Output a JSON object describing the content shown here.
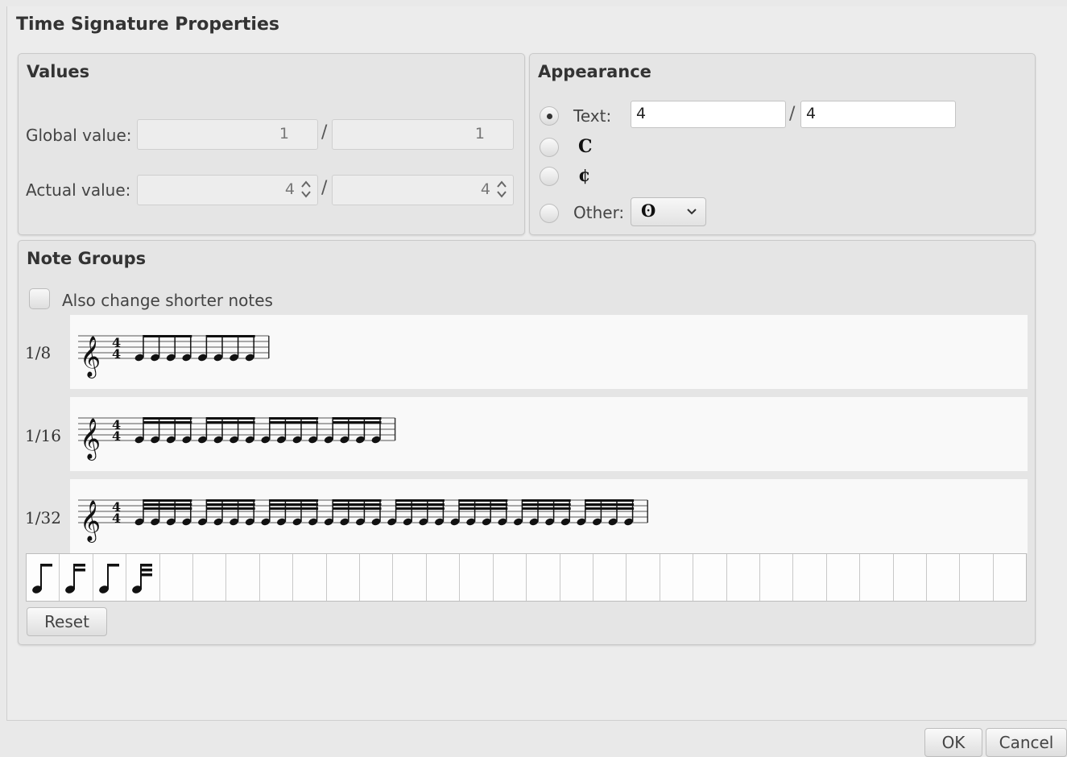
{
  "dialog": {
    "title": "Time Signature Properties",
    "ok_label": "OK",
    "cancel_label": "Cancel"
  },
  "values": {
    "title": "Values",
    "global_label": "Global value:",
    "global_numerator": "1",
    "global_denominator": "1",
    "actual_label": "Actual value:",
    "actual_numerator": "4",
    "actual_denominator": "4",
    "separator": "/"
  },
  "appearance": {
    "title": "Appearance",
    "text_label": "Text:",
    "text_numerator": "4",
    "text_denominator": "4",
    "separator": "/",
    "common_time_symbol": "C",
    "cut_time_symbol": "¢",
    "other_label": "Other:",
    "other_selected_symbol": "ʘ",
    "selected_option": "text"
  },
  "note_groups": {
    "title": "Note Groups",
    "shorter_notes_label": "Also change shorter notes",
    "shorter_notes_checked": false,
    "rows": [
      {
        "label": "1/8",
        "beam_groups": 2,
        "notes_per_group": 4,
        "beams": 1
      },
      {
        "label": "1/16",
        "beam_groups": 4,
        "notes_per_group": 4,
        "beams": 2
      },
      {
        "label": "1/32",
        "beam_groups": 8,
        "notes_per_group": 4,
        "beams": 3
      }
    ],
    "palette_icons": [
      "eighth-note-icon",
      "sixteenth-note-icon",
      "eighth-note-icon",
      "thirty-second-note-icon"
    ],
    "palette_cells": 30,
    "reset_label": "Reset"
  }
}
